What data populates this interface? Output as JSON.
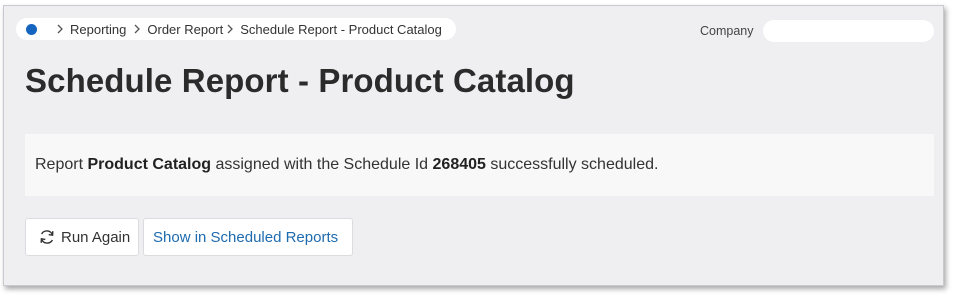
{
  "breadcrumb": {
    "home_icon": "home-dot-icon",
    "items": [
      {
        "label": "Reporting"
      },
      {
        "label": "Order Report"
      },
      {
        "label": "Schedule Report - Product Catalog"
      }
    ]
  },
  "company": {
    "label": "Company",
    "value": ""
  },
  "page": {
    "title": "Schedule Report - Product Catalog"
  },
  "message": {
    "prefix": "Report ",
    "report_name": "Product Catalog",
    "middle": " assigned with the Schedule Id ",
    "schedule_id": "268405",
    "suffix": " successfully scheduled."
  },
  "actions": {
    "run_again_label": "Run Again",
    "run_again_icon": "refresh-icon",
    "show_scheduled_label": "Show in Scheduled Reports"
  },
  "colors": {
    "accent": "#1565c0",
    "link": "#1e6bb0",
    "background": "#efeff2"
  }
}
